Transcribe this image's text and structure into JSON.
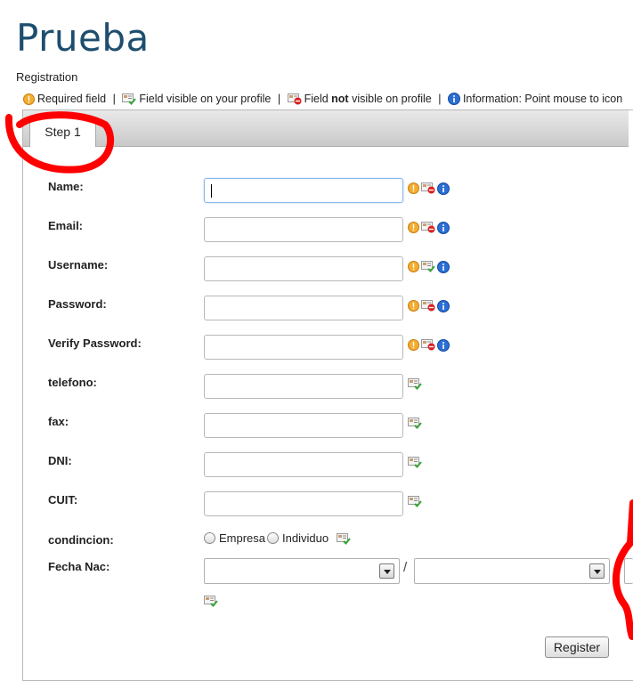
{
  "page": {
    "title": "Prueba",
    "subtitle": "Registration"
  },
  "legend": {
    "required": "Required field",
    "visible": "Field visible on your profile",
    "not_visible_prefix": "Field",
    "not_visible_bold": "not",
    "not_visible_suffix": "visible on profile",
    "info": "Information: Point mouse to icon",
    "separator": "|"
  },
  "tabs": [
    {
      "label": "Step 1",
      "active": true
    }
  ],
  "fields": [
    {
      "label": "Name:",
      "value": "",
      "focused": true,
      "icons": [
        "required-icon",
        "not-visible-icon",
        "info-icon"
      ]
    },
    {
      "label": "Email:",
      "value": "",
      "icons": [
        "required-icon",
        "not-visible-icon",
        "info-icon"
      ]
    },
    {
      "label": "Username:",
      "value": "",
      "icons": [
        "required-icon",
        "visible-icon",
        "info-icon"
      ]
    },
    {
      "label": "Password:",
      "value": "",
      "icons": [
        "required-icon",
        "not-visible-icon",
        "info-icon"
      ]
    },
    {
      "label": "Verify Password:",
      "value": "",
      "icons": [
        "required-icon",
        "not-visible-icon",
        "info-icon"
      ]
    },
    {
      "label": "telefono:",
      "value": "",
      "icons": [
        "visible-icon"
      ]
    },
    {
      "label": "fax:",
      "value": "",
      "icons": [
        "visible-icon"
      ]
    },
    {
      "label": "DNI:",
      "value": "",
      "icons": [
        "visible-icon"
      ]
    },
    {
      "label": "CUIT:",
      "value": "",
      "icons": [
        "visible-icon"
      ]
    }
  ],
  "condicion": {
    "label": "condincion:",
    "options": [
      "Empresa",
      "Individuo"
    ],
    "selected": null
  },
  "fecha_nac": {
    "label": "Fecha Nac:",
    "separator": "/"
  },
  "register_button": "Register",
  "colors": {
    "title": "#1d4e6e",
    "required_icon": "#f0a020",
    "info_icon": "#1e5fbf",
    "annotation": "#ff0000"
  }
}
